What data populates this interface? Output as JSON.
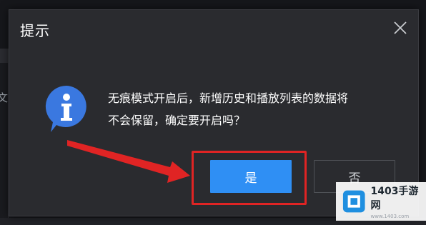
{
  "dialog": {
    "title": "提示",
    "message_line1": "无痕模式开启后，新增历史和播放列表的数据将",
    "message_line2": "不会保留，确定要开启吗？",
    "confirm_label": "是",
    "cancel_label": "否"
  },
  "background": {
    "left_fragment_text": "文"
  },
  "watermark": {
    "brand": "1403手游网",
    "url": "www.1403.com"
  },
  "colors": {
    "dialog_bg": "#2a2b2f",
    "primary_button": "#2f8ff4",
    "highlight_red": "#e02424",
    "info_icon_blue": "#3a78e0"
  },
  "icons": [
    "close-icon",
    "info-icon",
    "arrow-annotation",
    "watermark-logo-icon"
  ]
}
